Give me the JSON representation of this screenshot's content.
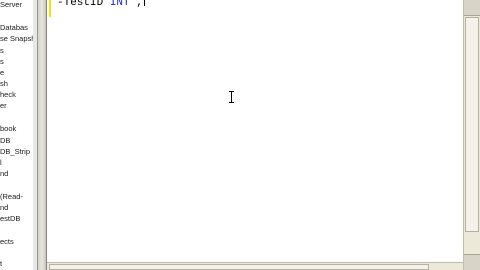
{
  "explorer": {
    "items": [
      {
        "label": "Server"
      },
      {
        "label": "Databas"
      },
      {
        "label": "se Snapsh"
      },
      {
        "label": "s"
      },
      {
        "label": "s"
      },
      {
        "label": "e"
      },
      {
        "label": "sh"
      },
      {
        "label": "heck"
      },
      {
        "label": "er"
      },
      {
        "label": "book"
      },
      {
        "label": "DB"
      },
      {
        "label": "DB_Strip"
      },
      {
        "label": "l"
      },
      {
        "label": "nd"
      },
      {
        "label": "(Read-"
      },
      {
        "label": "nd"
      },
      {
        "label": "estDB"
      },
      {
        "label": "ects"
      },
      {
        "label": "t"
      }
    ]
  },
  "editor": {
    "code": {
      "prefix": "-TestID ",
      "keyword": "INT",
      "suffix": " ,"
    }
  },
  "colors": {
    "keyword": "#2020c8",
    "change_bar": "#f2e600",
    "splitter": "#d4d0c8",
    "scrollbar": "#ece9d8"
  }
}
